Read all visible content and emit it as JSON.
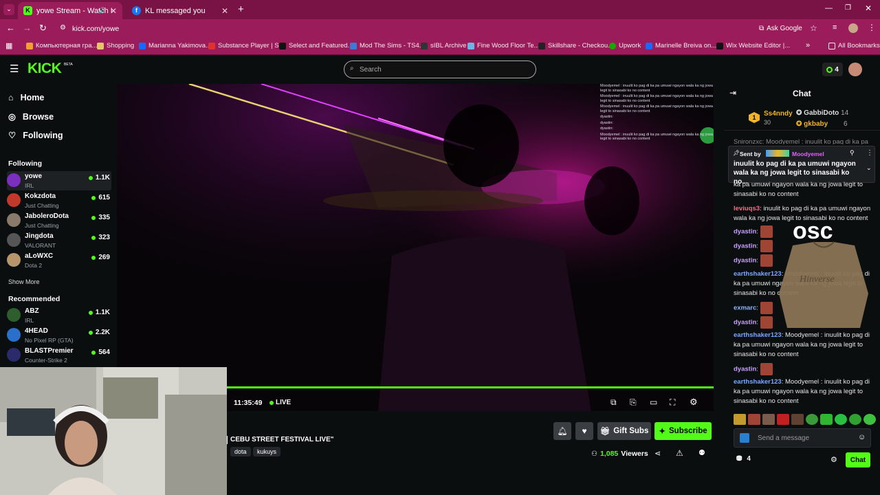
{
  "tabs": [
    {
      "title": "yowe Stream - Watch Live o",
      "icon": "kick-icon"
    },
    {
      "title": "KL messaged you",
      "icon": "facebook-icon"
    }
  ],
  "url": "kick.com/yowe",
  "ask_google": "Ask Google",
  "bookmarks": [
    "Компьютерная гра...",
    "Shopping",
    "Marianna Yakimova...",
    "Substance Player | S...",
    "Select and Featured...",
    "Mod The Sims - TS4...",
    "sIBL Archive",
    "Fine Wood Floor Te...",
    "Skillshare - Checkou...",
    "Upwork",
    "Marinelle Breiva on...",
    "Wix Website Editor |..."
  ],
  "all_bookmarks": "All Bookmarks",
  "header": {
    "logo": "KICK",
    "beta": "BETA",
    "search_placeholder": "Search",
    "kicks_count": "4"
  },
  "nav": {
    "home": "Home",
    "browse": "Browse",
    "following": "Following"
  },
  "following_title": "Following",
  "following": [
    {
      "name": "yowe",
      "category": "IRL",
      "viewers": "1.1K",
      "color": "#7b2fbf"
    },
    {
      "name": "Kokzdota",
      "category": "Just Chatting",
      "viewers": "615",
      "color": "#c0392b"
    },
    {
      "name": "JaboleroDota",
      "category": "Just Chatting",
      "viewers": "335",
      "color": "#8a7a6a"
    },
    {
      "name": "Jingdota",
      "category": "VALORANT",
      "viewers": "323",
      "color": "#555"
    },
    {
      "name": "aLoWXC",
      "category": "Dota 2",
      "viewers": "269",
      "color": "#b8956a"
    }
  ],
  "show_more": "Show More",
  "recommended_title": "Recommended",
  "recommended": [
    {
      "name": "ABZ",
      "category": "IRL",
      "viewers": "1.1K",
      "color": "#2e5e2e"
    },
    {
      "name": "4HEAD",
      "category": "No Pixel RP (GTA)",
      "viewers": "2.2K",
      "color": "#2a6fc9"
    },
    {
      "name": "BLASTPremier",
      "category": "Counter-Strike 2",
      "viewers": "564",
      "color": "#2b2b6b"
    }
  ],
  "overlay_chat": [
    "Moodyemel : inuulit ko pag di ka pa umuwi ngayon wala ka ng jowa legit to sinasabi ko no content",
    "Moodyemel : inuulit ko pag di ka pa umuwi ngayon wala ka ng jowa legit to sinasabi ko no content",
    "Moodyemel : inuulit ko pag di ka pa umuwi ngayon wala ka ng jowa legit to sinasabi ko no content",
    "dyastin:",
    "dyastin:",
    "dyastin:",
    "Moodyemel : inuulit ko pag di ka pa umuwi ngayon wala ka ng jowa legit to sinasabi ko no content"
  ],
  "player": {
    "time": "11:35:49",
    "live": "LIVE",
    "progress": 1.0
  },
  "stream": {
    "title": "CEBU STREET FESTIVAL LIVE\"",
    "tags": [
      "dota",
      "kukuys"
    ],
    "viewers": "1,085",
    "viewers_label": "Viewers"
  },
  "buttons": {
    "gift_subs": "Gift Subs",
    "subscribe": "Subscribe"
  },
  "chat": {
    "title": "Chat",
    "leaderboard": [
      {
        "rank": "1",
        "name": "Ss4nndy",
        "count": "30"
      },
      {
        "name": "GabbiDoto",
        "count": "14"
      },
      {
        "name": "gkbaby",
        "count": "6"
      }
    ],
    "pinned_sent_by": "Sent by",
    "pinned_user": "Moodyemel",
    "pinned_text": "inuulit ko pag di ka pa umuwi ngayon wala ka ng jowa legit to sinasabi ko no...",
    "partial_top": "Snironzxc: Moodyemel : inuulit ko pag di ka pa",
    "messages": [
      {
        "user": "",
        "text": "ka pa umuwi ngayon wala ka ng jowa legit to sinasabi ko no content"
      },
      {
        "user": "leviuqs3",
        "text": "inuulit ko pag di ka pa umuwi ngayon wala ka ng jowa legit to sinasabi ko no content"
      },
      {
        "user": "dyastin",
        "text": ""
      },
      {
        "user": "dyastin",
        "text": ""
      },
      {
        "user": "dyastin",
        "text": ""
      },
      {
        "user": "earthshaker123",
        "text": "Moodyemel : inuulit ko pag di ka pa umuwi ngayon wala ka ng jowa legit to sinasabi ko no content"
      },
      {
        "user": "exmarc",
        "text": ""
      },
      {
        "user": "dyastin",
        "text": ""
      },
      {
        "user": "earthshaker123",
        "text": "Moodyemel : inuulit ko pag di ka pa umuwi ngayon wala ka ng jowa legit to sinasabi ko no content"
      },
      {
        "user": "dyastin",
        "text": ""
      },
      {
        "user": "earthshaker123",
        "text": "Moodyemel : inuulit ko pag di ka pa umuwi ngayon wala ka ng jowa legit to sinasabi ko no content"
      }
    ],
    "input_placeholder": "Send a message",
    "points": "4",
    "send_label": "Chat"
  },
  "overlay_brand": "Hinverse",
  "colors": {
    "accent": "#53fc18",
    "tabbar": "#7a1345",
    "toolbar": "#9b1c5a",
    "bg": "#0b0e0f"
  }
}
